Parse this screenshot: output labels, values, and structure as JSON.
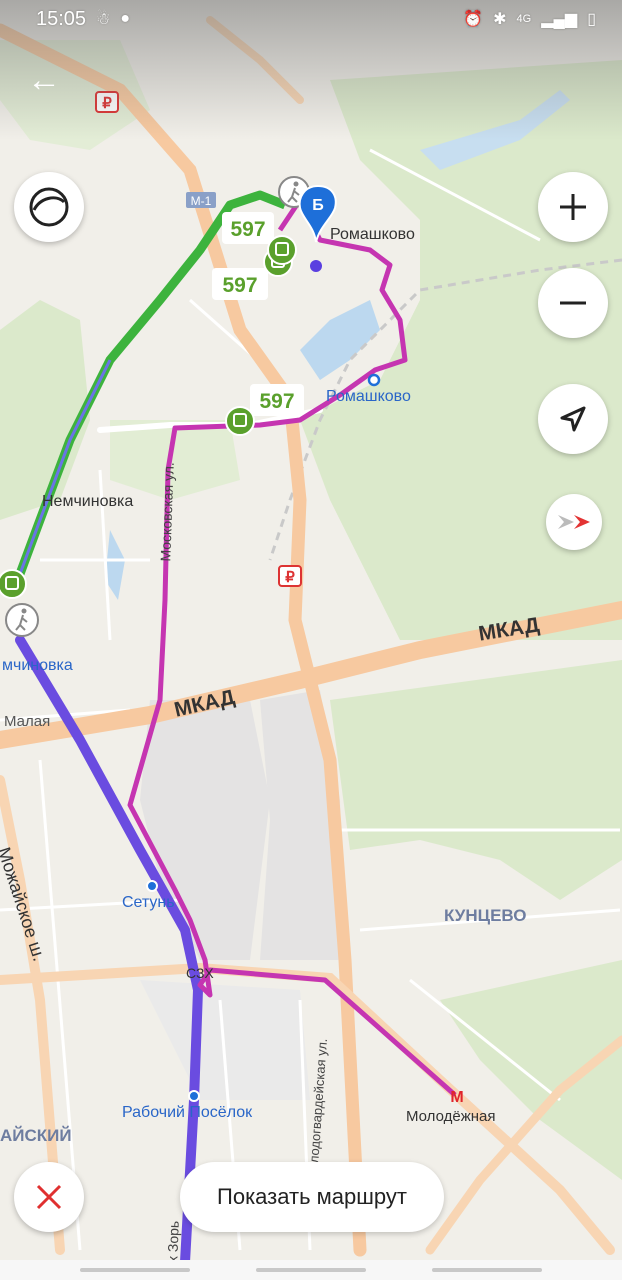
{
  "status_bar": {
    "time": "15:05",
    "network": "4G"
  },
  "map": {
    "place_labels": {
      "romashkovo_village": "Ромашково",
      "romashkovo_station": "Ромашково",
      "nemchinovka": "Немчиновка",
      "nemchinovka_station": "мчиновка",
      "malaya": "Малая",
      "setun": "Сетунь",
      "rabochiy_posyolok": "Рабочий Посёлок",
      "molodyozhnaya": "Молодёжная",
      "kuntsevo": "КУНЦЕВО",
      "kaisky": "АЙСКИЙ",
      "szh": "СЗХ"
    },
    "road_labels": {
      "mkad_upper": "МКАД",
      "mkad_lower": "МКАД",
      "m1": "М-1",
      "moskovskaya": "Московская ул.",
      "mozhayskoe": "Можайское ш.",
      "molodogvardeyskaya": "Молодогвардейская ул.",
      "zori": "х Зорь"
    },
    "bus_route_labels": [
      "597",
      "597",
      "597"
    ],
    "marker_b": "Б",
    "metro_letter": "М"
  },
  "buttons": {
    "show_route": "Показать маршрут"
  },
  "colors": {
    "route_magenta": "#c535b1",
    "route_green": "#3db33d",
    "route_purple": "#6a4ce0",
    "pin_blue": "#1e6fd9",
    "road_orange": "#f7c79b",
    "forest": "#d9ebc6",
    "water": "#b8d7ee",
    "bus_green": "#5aa02c"
  }
}
